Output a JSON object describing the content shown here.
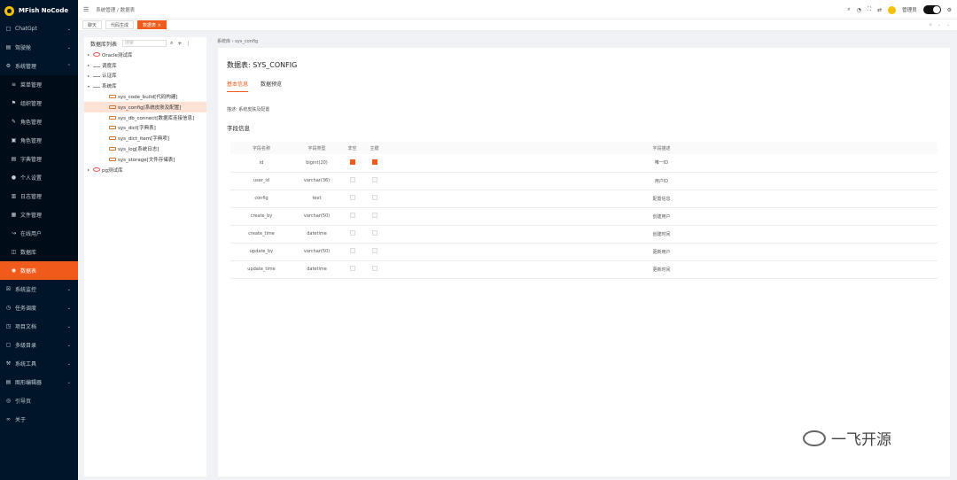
{
  "app": {
    "title": "MFish NoCode"
  },
  "menu": [
    {
      "icon": "□",
      "label": "ChatGpt",
      "arrow": "⌄",
      "sub": false,
      "active": false
    },
    {
      "icon": "▤",
      "label": "驾驶舱",
      "arrow": "⌄",
      "sub": false,
      "active": false
    },
    {
      "icon": "⚙",
      "label": "系统管理",
      "arrow": "⌃",
      "sub": false,
      "active": false
    },
    {
      "icon": "≡",
      "label": "菜单管理",
      "arrow": "",
      "sub": true,
      "active": false
    },
    {
      "icon": "⚑",
      "label": "组织管理",
      "arrow": "",
      "sub": true,
      "active": false
    },
    {
      "icon": "✎",
      "label": "角色管理",
      "arrow": "",
      "sub": true,
      "active": false
    },
    {
      "icon": "▣",
      "label": "角色管理",
      "arrow": "",
      "sub": true,
      "active": false
    },
    {
      "icon": "▤",
      "label": "字典管理",
      "arrow": "",
      "sub": true,
      "active": false
    },
    {
      "icon": "●",
      "label": "个人设置",
      "arrow": "",
      "sub": true,
      "active": false
    },
    {
      "icon": "▥",
      "label": "日志管理",
      "arrow": "",
      "sub": true,
      "active": false
    },
    {
      "icon": "▦",
      "label": "文件管理",
      "arrow": "",
      "sub": true,
      "active": false
    },
    {
      "icon": "↝",
      "label": "在线用户",
      "arrow": "",
      "sub": true,
      "active": false
    },
    {
      "icon": "◫",
      "label": "数据库",
      "arrow": "",
      "sub": true,
      "active": false
    },
    {
      "icon": "◉",
      "label": "数据表",
      "arrow": "",
      "sub": true,
      "active": true
    },
    {
      "icon": "☒",
      "label": "系统监控",
      "arrow": "⌄",
      "sub": false,
      "active": false
    },
    {
      "icon": "◷",
      "label": "任务调度",
      "arrow": "⌄",
      "sub": false,
      "active": false
    },
    {
      "icon": "◳",
      "label": "项目文档",
      "arrow": "⌄",
      "sub": false,
      "active": false
    },
    {
      "icon": "▢",
      "label": "多级目录",
      "arrow": "⌄",
      "sub": false,
      "active": false
    },
    {
      "icon": "⚒",
      "label": "系统工具",
      "arrow": "⌄",
      "sub": false,
      "active": false
    },
    {
      "icon": "▤",
      "label": "图形编辑器",
      "arrow": "⌄",
      "sub": false,
      "active": false
    },
    {
      "icon": "◎",
      "label": "引导页",
      "arrow": "",
      "sub": false,
      "active": false
    },
    {
      "icon": "∞",
      "label": "关于",
      "arrow": "",
      "sub": false,
      "active": false
    }
  ],
  "topbar": {
    "breadcrumb": "系统管理 / 数据表",
    "menu_icon": "☰",
    "user": "管理员",
    "icons": [
      "⌕",
      "◔",
      "⛶",
      "⇄"
    ]
  },
  "tabs": [
    {
      "label": "聊天",
      "active": false
    },
    {
      "label": "代码生成",
      "active": false
    },
    {
      "label": "数据表 ×",
      "active": true
    }
  ],
  "tabs_controls": [
    "⌂",
    "⌄",
    "⌄"
  ],
  "tree": {
    "title": "数据库列表",
    "search_placeholder": "搜索",
    "actions": [
      "⌕",
      "+",
      "⋮"
    ],
    "nodes": [
      {
        "label": "Oracle测试库",
        "level": 1,
        "caret": "▸",
        "kind": "o",
        "sel": false
      },
      {
        "label": "调度库",
        "level": 1,
        "caret": "▸",
        "kind": "d",
        "sel": false
      },
      {
        "label": "认证库",
        "level": 1,
        "caret": "▸",
        "kind": "d",
        "sel": false
      },
      {
        "label": "系统库",
        "level": 1,
        "caret": "▾",
        "kind": "d",
        "sel": false
      },
      {
        "label": "sys_code_build[代码构建]",
        "level": 2,
        "caret": "",
        "kind": "t",
        "sel": false
      },
      {
        "label": "sys_config[系统皮肤及配置]",
        "level": 2,
        "caret": "",
        "kind": "t",
        "sel": true
      },
      {
        "label": "sys_db_connect[数据库连接信息]",
        "level": 2,
        "caret": "",
        "kind": "t",
        "sel": false
      },
      {
        "label": "sys_dict[字典表]",
        "level": 2,
        "caret": "",
        "kind": "t",
        "sel": false
      },
      {
        "label": "sys_dict_item[字典项]",
        "level": 2,
        "caret": "",
        "kind": "t",
        "sel": false
      },
      {
        "label": "sys_log[系统日志]",
        "level": 2,
        "caret": "",
        "kind": "t",
        "sel": false
      },
      {
        "label": "sys_storage[文件存储表]",
        "level": 2,
        "caret": "",
        "kind": "t",
        "sel": false
      },
      {
        "label": "pg测试库",
        "level": 1,
        "caret": "▸",
        "kind": "o",
        "sel": false
      }
    ]
  },
  "page": {
    "breadcrumb": "系统库 › sys_config",
    "title": "数据表: SYS_CONFIG",
    "tabs": [
      {
        "label": "基本信息",
        "active": true
      },
      {
        "label": "数据预览",
        "active": false
      }
    ],
    "description": "描述: 系统皮肤及配置",
    "fields_title": "字段信息",
    "columns": [
      "字段名称",
      "字段类型",
      "非空",
      "主键",
      "字段描述"
    ],
    "rows": [
      {
        "name": "id",
        "type": "bigint(20)",
        "notnull": true,
        "pk": true,
        "desc": "唯一ID"
      },
      {
        "name": "user_id",
        "type": "varchar(36)",
        "notnull": false,
        "pk": false,
        "desc": "用户ID"
      },
      {
        "name": "config",
        "type": "text",
        "notnull": false,
        "pk": false,
        "desc": "配置信息"
      },
      {
        "name": "create_by",
        "type": "varchar(50)",
        "notnull": false,
        "pk": false,
        "desc": "创建用户"
      },
      {
        "name": "create_time",
        "type": "datetime",
        "notnull": false,
        "pk": false,
        "desc": "创建时间"
      },
      {
        "name": "update_by",
        "type": "varchar(50)",
        "notnull": false,
        "pk": false,
        "desc": "更新用户"
      },
      {
        "name": "update_time",
        "type": "datetime",
        "notnull": false,
        "pk": false,
        "desc": "更新时间"
      }
    ]
  },
  "watermark": "一飞开源",
  "colors": {
    "accent": "#f05a1a",
    "sidebar": "#001529"
  }
}
